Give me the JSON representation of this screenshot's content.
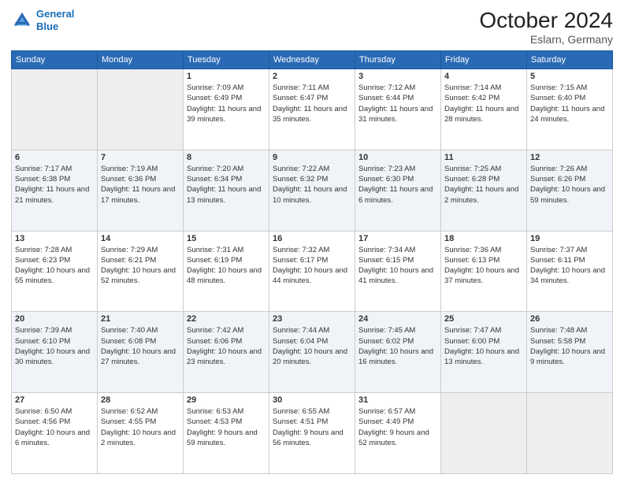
{
  "header": {
    "logo_line1": "General",
    "logo_line2": "Blue",
    "month": "October 2024",
    "location": "Eslarn, Germany"
  },
  "weekdays": [
    "Sunday",
    "Monday",
    "Tuesday",
    "Wednesday",
    "Thursday",
    "Friday",
    "Saturday"
  ],
  "weeks": [
    [
      {
        "day": null
      },
      {
        "day": null
      },
      {
        "day": "1",
        "sunrise": "7:09 AM",
        "sunset": "6:49 PM",
        "daylight": "11 hours and 39 minutes."
      },
      {
        "day": "2",
        "sunrise": "7:11 AM",
        "sunset": "6:47 PM",
        "daylight": "11 hours and 35 minutes."
      },
      {
        "day": "3",
        "sunrise": "7:12 AM",
        "sunset": "6:44 PM",
        "daylight": "11 hours and 31 minutes."
      },
      {
        "day": "4",
        "sunrise": "7:14 AM",
        "sunset": "6:42 PM",
        "daylight": "11 hours and 28 minutes."
      },
      {
        "day": "5",
        "sunrise": "7:15 AM",
        "sunset": "6:40 PM",
        "daylight": "11 hours and 24 minutes."
      }
    ],
    [
      {
        "day": "6",
        "sunrise": "7:17 AM",
        "sunset": "6:38 PM",
        "daylight": "11 hours and 21 minutes."
      },
      {
        "day": "7",
        "sunrise": "7:19 AM",
        "sunset": "6:36 PM",
        "daylight": "11 hours and 17 minutes."
      },
      {
        "day": "8",
        "sunrise": "7:20 AM",
        "sunset": "6:34 PM",
        "daylight": "11 hours and 13 minutes."
      },
      {
        "day": "9",
        "sunrise": "7:22 AM",
        "sunset": "6:32 PM",
        "daylight": "11 hours and 10 minutes."
      },
      {
        "day": "10",
        "sunrise": "7:23 AM",
        "sunset": "6:30 PM",
        "daylight": "11 hours and 6 minutes."
      },
      {
        "day": "11",
        "sunrise": "7:25 AM",
        "sunset": "6:28 PM",
        "daylight": "11 hours and 2 minutes."
      },
      {
        "day": "12",
        "sunrise": "7:26 AM",
        "sunset": "6:26 PM",
        "daylight": "10 hours and 59 minutes."
      }
    ],
    [
      {
        "day": "13",
        "sunrise": "7:28 AM",
        "sunset": "6:23 PM",
        "daylight": "10 hours and 55 minutes."
      },
      {
        "day": "14",
        "sunrise": "7:29 AM",
        "sunset": "6:21 PM",
        "daylight": "10 hours and 52 minutes."
      },
      {
        "day": "15",
        "sunrise": "7:31 AM",
        "sunset": "6:19 PM",
        "daylight": "10 hours and 48 minutes."
      },
      {
        "day": "16",
        "sunrise": "7:32 AM",
        "sunset": "6:17 PM",
        "daylight": "10 hours and 44 minutes."
      },
      {
        "day": "17",
        "sunrise": "7:34 AM",
        "sunset": "6:15 PM",
        "daylight": "10 hours and 41 minutes."
      },
      {
        "day": "18",
        "sunrise": "7:36 AM",
        "sunset": "6:13 PM",
        "daylight": "10 hours and 37 minutes."
      },
      {
        "day": "19",
        "sunrise": "7:37 AM",
        "sunset": "6:11 PM",
        "daylight": "10 hours and 34 minutes."
      }
    ],
    [
      {
        "day": "20",
        "sunrise": "7:39 AM",
        "sunset": "6:10 PM",
        "daylight": "10 hours and 30 minutes."
      },
      {
        "day": "21",
        "sunrise": "7:40 AM",
        "sunset": "6:08 PM",
        "daylight": "10 hours and 27 minutes."
      },
      {
        "day": "22",
        "sunrise": "7:42 AM",
        "sunset": "6:06 PM",
        "daylight": "10 hours and 23 minutes."
      },
      {
        "day": "23",
        "sunrise": "7:44 AM",
        "sunset": "6:04 PM",
        "daylight": "10 hours and 20 minutes."
      },
      {
        "day": "24",
        "sunrise": "7:45 AM",
        "sunset": "6:02 PM",
        "daylight": "10 hours and 16 minutes."
      },
      {
        "day": "25",
        "sunrise": "7:47 AM",
        "sunset": "6:00 PM",
        "daylight": "10 hours and 13 minutes."
      },
      {
        "day": "26",
        "sunrise": "7:48 AM",
        "sunset": "5:58 PM",
        "daylight": "10 hours and 9 minutes."
      }
    ],
    [
      {
        "day": "27",
        "sunrise": "6:50 AM",
        "sunset": "4:56 PM",
        "daylight": "10 hours and 6 minutes."
      },
      {
        "day": "28",
        "sunrise": "6:52 AM",
        "sunset": "4:55 PM",
        "daylight": "10 hours and 2 minutes."
      },
      {
        "day": "29",
        "sunrise": "6:53 AM",
        "sunset": "4:53 PM",
        "daylight": "9 hours and 59 minutes."
      },
      {
        "day": "30",
        "sunrise": "6:55 AM",
        "sunset": "4:51 PM",
        "daylight": "9 hours and 56 minutes."
      },
      {
        "day": "31",
        "sunrise": "6:57 AM",
        "sunset": "4:49 PM",
        "daylight": "9 hours and 52 minutes."
      },
      {
        "day": null
      },
      {
        "day": null
      }
    ]
  ]
}
